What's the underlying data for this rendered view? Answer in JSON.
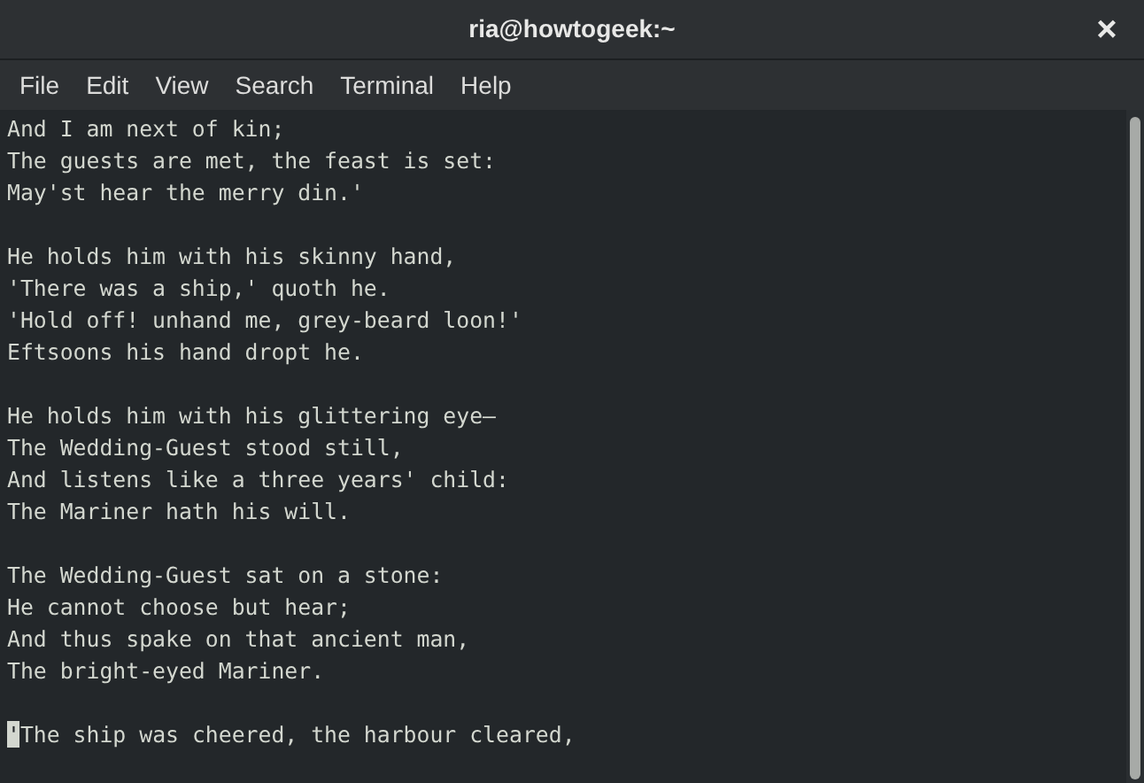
{
  "window": {
    "title": "ria@howtogeek:~",
    "close": "×"
  },
  "menu": [
    "File",
    "Edit",
    "View",
    "Search",
    "Terminal",
    "Help"
  ],
  "stanzas": [
    {
      "cursor_at_start": false,
      "lines": [
        "And I am next of kin;",
        "The guests are met, the feast is set:",
        "May'st hear the merry din.'"
      ]
    },
    {
      "cursor_at_start": false,
      "lines": [
        "He holds him with his skinny hand,",
        "'There was a ship,' quoth he.",
        "'Hold off! unhand me, grey-beard loon!'",
        "Eftsoons his hand dropt he."
      ]
    },
    {
      "cursor_at_start": false,
      "lines": [
        "He holds him with his glittering eye—",
        "The Wedding-Guest stood still,",
        "And listens like a three years' child:",
        "The Mariner hath his will."
      ]
    },
    {
      "cursor_at_start": false,
      "lines": [
        "The Wedding-Guest sat on a stone:",
        "He cannot choose but hear;",
        "And thus spake on that ancient man,",
        "The bright-eyed Mariner."
      ]
    },
    {
      "cursor_at_start": true,
      "lines": [
        "'The ship was cheered, the harbour cleared,"
      ]
    }
  ]
}
